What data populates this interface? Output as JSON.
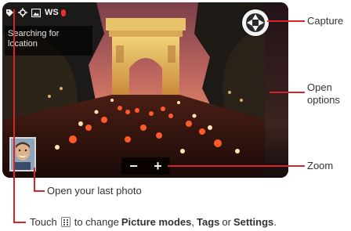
{
  "viewfinder": {
    "status_text": "WS",
    "searching_line1": "Searching for",
    "searching_line2": "location",
    "capture_icon": "camera-shutter-icon",
    "thumbnail_icon": "last-photo-thumbnail",
    "zoom_out": "−",
    "zoom_in": "+",
    "status_icons": [
      "tag-icon",
      "gps-icon",
      "picture-mode-icon"
    ]
  },
  "callouts": {
    "capture": "Capture",
    "open_options_line1": "Open",
    "open_options_line2": "options",
    "zoom": "Zoom",
    "last_photo": "Open your last photo"
  },
  "instruction": {
    "prefix": "Touch",
    "middle": "to change",
    "picture_modes": "Picture modes",
    "comma": ",",
    "tags": "Tags",
    "or": "or",
    "settings": "Settings",
    "period": "."
  },
  "colors": {
    "callout_line": "#d8232a",
    "text": "#333333"
  }
}
